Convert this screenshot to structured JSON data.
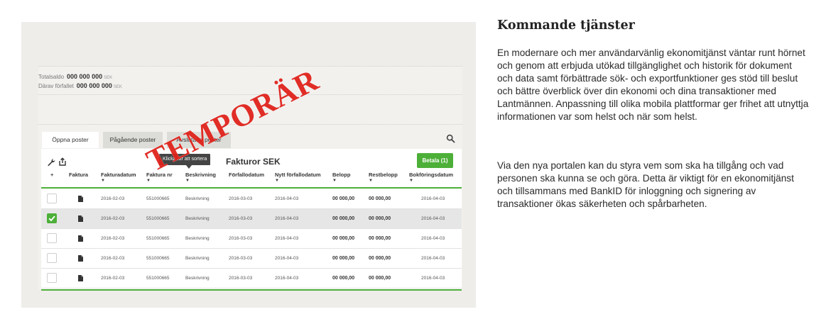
{
  "panel": {
    "saldo": [
      {
        "label": "Totalsaldo",
        "value": "000 000 000",
        "unit": "SEK"
      },
      {
        "label": "Därav förfallet",
        "value": "000 000 000",
        "unit": "SEK"
      }
    ],
    "tabs": [
      "Öppna poster",
      "Pågående poster",
      "Avslutade poster"
    ],
    "active_tab": "Öppna poster",
    "table_title": "Fakturor SEK",
    "pay_button": "Betala (1)",
    "columns": [
      "+",
      "Faktura",
      "Fakturadatum",
      "Faktura nr",
      "Beskrivning",
      "Förfallodatum",
      "Nytt förfallodatum",
      "Belopp",
      "Restbelopp",
      "Bokföringsdatum"
    ],
    "rows": [
      {
        "checked": false,
        "fakturadatum": "2016-02-03",
        "faktura_nr": "551000665",
        "beskrivning": "Beskrivning",
        "forfallodatum": "2016-03-03",
        "nytt": "2016-04-03",
        "belopp": "00 000,00",
        "restbelopp": "00 000,00",
        "bokforing": "2016-04-03"
      },
      {
        "checked": true,
        "fakturadatum": "2016-02-03",
        "faktura_nr": "551000665",
        "beskrivning": "Beskrivning",
        "forfallodatum": "2016-03-03",
        "nytt": "2016-04-03",
        "belopp": "00 000,00",
        "restbelopp": "00 000,00",
        "bokforing": "2016-04-03"
      },
      {
        "checked": false,
        "fakturadatum": "2016-02-03",
        "faktura_nr": "551000665",
        "beskrivning": "Beskrivning",
        "forfallodatum": "2016-03-03",
        "nytt": "2016-04-03",
        "belopp": "00 000,00",
        "restbelopp": "00 000,00",
        "bokforing": "2016-04-03"
      },
      {
        "checked": false,
        "fakturadatum": "2016-02-03",
        "faktura_nr": "551000665",
        "beskrivning": "Beskrivning",
        "forfallodatum": "2016-03-03",
        "nytt": "2016-04-03",
        "belopp": "00 000,00",
        "restbelopp": "00 000,00",
        "bokforing": "2016-04-03"
      },
      {
        "checked": false,
        "fakturadatum": "2016-02-03",
        "faktura_nr": "551000665",
        "beskrivning": "Beskrivning",
        "forfallodatum": "2016-03-03",
        "nytt": "2016-04-03",
        "belopp": "00 000,00",
        "restbelopp": "00 000,00",
        "bokforing": "2016-04-03"
      }
    ],
    "tooltip": "Klicka för att sortera",
    "stamp": "TEMPORÄR",
    "icons": [
      "wrench-icon",
      "export-icon",
      "search-icon",
      "document-icon",
      "checkmark-icon"
    ],
    "colors": {
      "accent_green": "#4caf38",
      "stamp_red": "#e0231c"
    }
  },
  "article": {
    "heading": "Kommande tjänster",
    "paragraphs": [
      "En modernare och mer användarvänlig ekonomitjänst väntar runt hörnet och genom att erbjuda utökad tillgänglighet och historik för dokument och data samt förbättrade sök- och exportfunktioner ges stöd till beslut och bättre överblick över din ekonomi och dina transaktioner med Lantmännen. Anpassning till olika mobila plattformar ger frihet att utnyttja informationen var som helst och när som helst.",
      "Via den nya portalen kan du styra vem som ska ha tillgång och vad personen ska kunna se och göra. Detta är viktigt för en ekonomitjänst och tillsammans med BankID för inloggning och signering av transaktioner ökas säkerheten och spårbarheten."
    ]
  }
}
